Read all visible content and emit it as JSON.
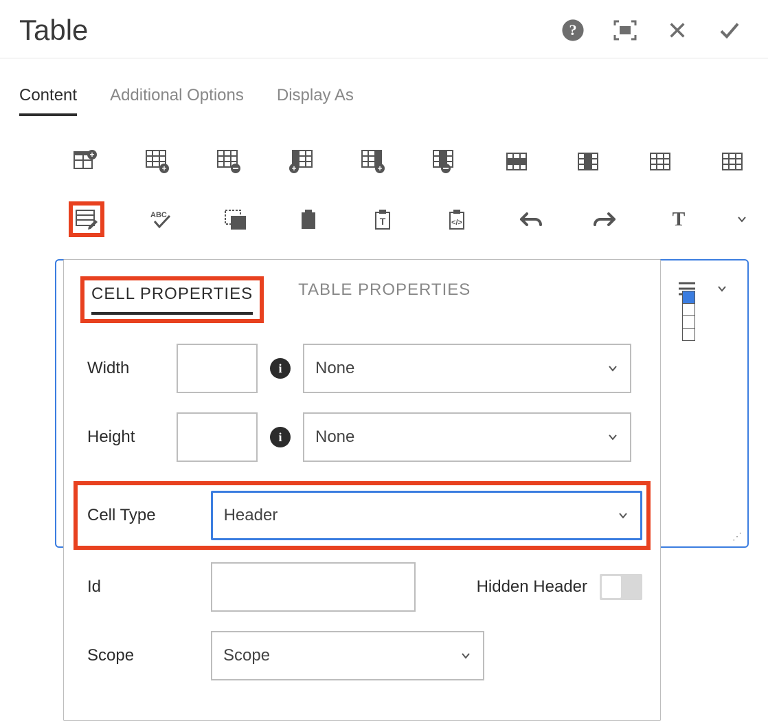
{
  "header": {
    "title": "Table"
  },
  "tabs": [
    {
      "label": "Content",
      "active": true
    },
    {
      "label": "Additional Options",
      "active": false
    },
    {
      "label": "Display As",
      "active": false
    }
  ],
  "popover": {
    "tabs": [
      {
        "label": "CELL PROPERTIES",
        "active": true
      },
      {
        "label": "TABLE PROPERTIES",
        "active": false
      }
    ],
    "fields": {
      "width_label": "Width",
      "width_value": "",
      "width_unit": "None",
      "height_label": "Height",
      "height_value": "",
      "height_unit": "None",
      "cell_type_label": "Cell Type",
      "cell_type_value": "Header",
      "id_label": "Id",
      "id_value": "",
      "hidden_header_label": "Hidden Header",
      "hidden_header_value": false,
      "scope_label": "Scope",
      "scope_value": "Scope"
    }
  }
}
